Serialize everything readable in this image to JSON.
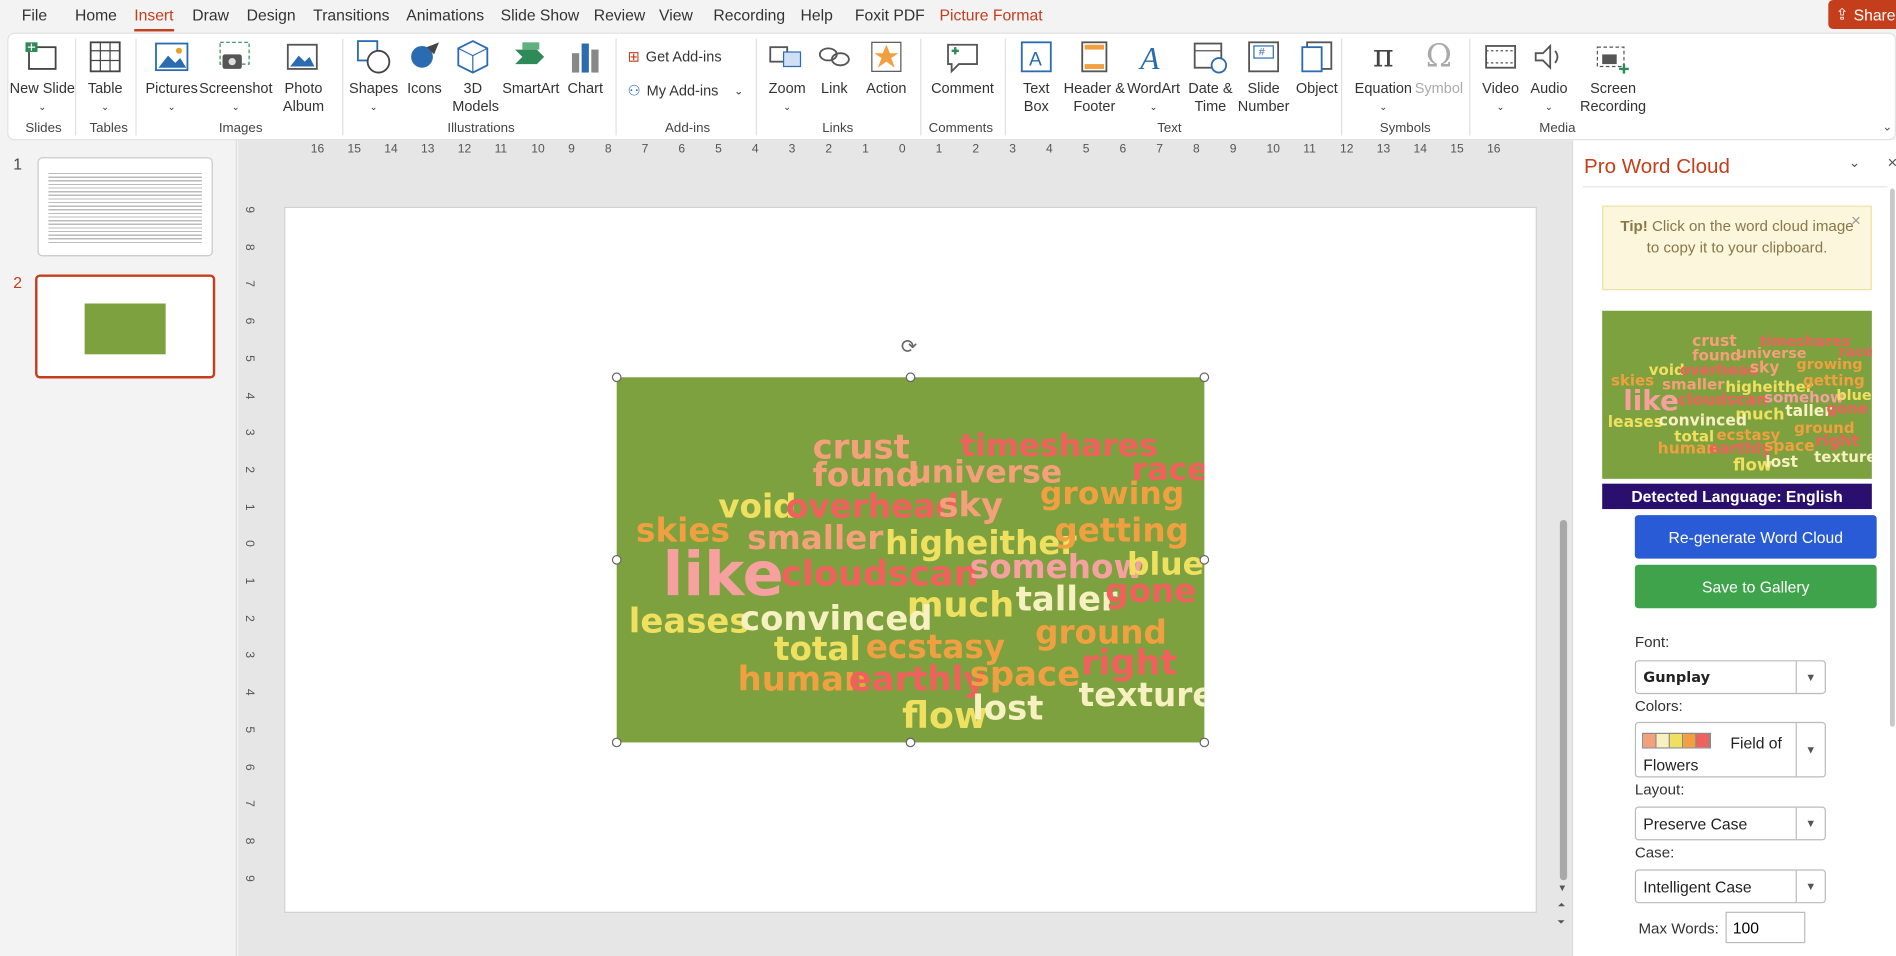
{
  "menu": {
    "tabs": [
      "File",
      "Home",
      "Insert",
      "Draw",
      "Design",
      "Transitions",
      "Animations",
      "Slide Show",
      "Review",
      "View",
      "Recording",
      "Help",
      "Foxit PDF",
      "Picture Format"
    ],
    "active": "Insert",
    "share": "Share"
  },
  "ribbon": {
    "new_slide": "New Slide",
    "table": "Table",
    "pictures": "Pictures",
    "screenshot": "Screenshot",
    "photo_album": "Photo Album",
    "shapes": "Shapes",
    "icons": "Icons",
    "models3d": "3D Models",
    "smartart": "SmartArt",
    "chart": "Chart",
    "get_addins": "Get Add-ins",
    "my_addins": "My Add-ins",
    "zoom": "Zoom",
    "link": "Link",
    "action": "Action",
    "comment": "Comment",
    "text_box": "Text Box",
    "header_footer": "Header & Footer",
    "wordart": "WordArt",
    "date_time": "Date & Time",
    "slide_number": "Slide Number",
    "object": "Object",
    "equation": "Equation",
    "symbol": "Symbol",
    "video": "Video",
    "audio": "Audio",
    "screen_recording": "Screen Recording",
    "groups": {
      "slides": "Slides",
      "tables": "Tables",
      "images": "Images",
      "illustrations": "Illustrations",
      "addins": "Add-ins",
      "links": "Links",
      "comments": "Comments",
      "text": "Text",
      "symbols": "Symbols",
      "media": "Media"
    }
  },
  "slides": {
    "n1": "1",
    "n2": "2"
  },
  "ruler": {
    "h": [
      "16",
      "15",
      "14",
      "13",
      "12",
      "11",
      "10",
      "9",
      "8",
      "7",
      "6",
      "5",
      "4",
      "3",
      "2",
      "1",
      "0",
      "1",
      "2",
      "3",
      "4",
      "5",
      "6",
      "7",
      "8",
      "9",
      "10",
      "11",
      "12",
      "13",
      "14",
      "15",
      "16"
    ],
    "v": [
      "9",
      "8",
      "7",
      "6",
      "5",
      "4",
      "3",
      "2",
      "1",
      "0",
      "1",
      "2",
      "3",
      "4",
      "5",
      "6",
      "7",
      "8",
      "9"
    ]
  },
  "wordcloud": {
    "words": [
      {
        "t": "crust",
        "c": "#f4a07a"
      },
      {
        "t": "timeshares",
        "c": "#f0605c"
      },
      {
        "t": "found",
        "c": "#f4a07a"
      },
      {
        "t": "universe",
        "c": "#f4a07a"
      },
      {
        "t": "race",
        "c": "#f0605c"
      },
      {
        "t": "void",
        "c": "#f0e060"
      },
      {
        "t": "overhead",
        "c": "#f0605c"
      },
      {
        "t": "sky",
        "c": "#f4a07a"
      },
      {
        "t": "growing",
        "c": "#f0a040"
      },
      {
        "t": "skies",
        "c": "#f0a040"
      },
      {
        "t": "smaller",
        "c": "#f4a07a"
      },
      {
        "t": "higheither",
        "c": "#f0e060"
      },
      {
        "t": "getting",
        "c": "#f0a040"
      },
      {
        "t": "like",
        "c": "#f7a0a0"
      },
      {
        "t": "cloudscan",
        "c": "#f0605c"
      },
      {
        "t": "somehow",
        "c": "#f7a0a0"
      },
      {
        "t": "blue",
        "c": "#f0e060"
      },
      {
        "t": "much",
        "c": "#f0e060"
      },
      {
        "t": "taller",
        "c": "#f7f0c0"
      },
      {
        "t": "gone",
        "c": "#f0605c"
      },
      {
        "t": "leases",
        "c": "#f0e060"
      },
      {
        "t": "convinced",
        "c": "#f7f0c0"
      },
      {
        "t": "ground",
        "c": "#f0a040"
      },
      {
        "t": "total",
        "c": "#f0e060"
      },
      {
        "t": "ecstasy",
        "c": "#f0a040"
      },
      {
        "t": "right",
        "c": "#f0605c"
      },
      {
        "t": "human",
        "c": "#f0a040"
      },
      {
        "t": "earthly",
        "c": "#f0605c"
      },
      {
        "t": "space",
        "c": "#f0a040"
      },
      {
        "t": "texture",
        "c": "#f7f0c0"
      },
      {
        "t": "flow",
        "c": "#f0e060"
      },
      {
        "t": "lost",
        "c": "#f7f0c0"
      }
    ]
  },
  "pane": {
    "title": "Pro Word Cloud",
    "tip_bold": "Tip!",
    "tip_text": "Click on the word cloud image to copy it to your clipboard.",
    "detected": "Detected Language: English",
    "regenerate": "Re-generate Word Cloud",
    "save": "Save to Gallery",
    "font_label": "Font:",
    "font_value": "Gunplay",
    "colors_label": "Colors:",
    "colors_value": "Field of Flowers",
    "swatches": [
      "#f4a07a",
      "#f7f0c0",
      "#f0e060",
      "#f0a040",
      "#f0605c"
    ],
    "layout_label": "Layout:",
    "layout_value": "Preserve Case",
    "case_label": "Case:",
    "case_value": "Intelligent Case",
    "max_words_label": "Max Words:",
    "max_words_value": "100"
  }
}
